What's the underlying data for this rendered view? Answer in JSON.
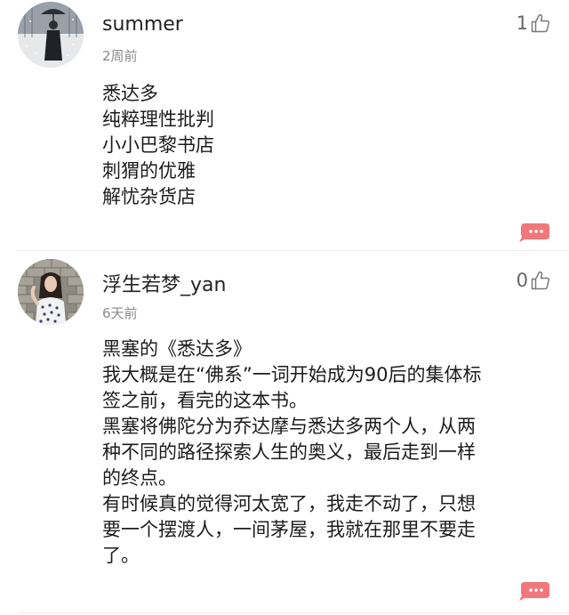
{
  "comments": [
    {
      "username": "summer",
      "time": "2周前",
      "likes": "1",
      "avatar_icon": "avatar-woman-umbrella-snow",
      "lines": [
        "悉达多",
        "纯粹理性批判",
        "小小巴黎书店",
        "刺猬的优雅",
        "解忧杂货店"
      ]
    },
    {
      "username": "浮生若梦_yan",
      "time": "6天前",
      "likes": "0",
      "avatar_icon": "avatar-woman-stone-wall",
      "lines": [
        "黑塞的《悉达多》",
        "我大概是在“佛系”一词开始成为90后的集体标",
        "签之前，看完的这本书。",
        "黑塞将佛陀分为乔达摩与悉达多两个人，从两",
        "种不同的路径探索人生的奥义，最后走到一样",
        "的终点。",
        "有时候真的觉得河太宽了，我走不动了，只想",
        "要一个摆渡人，一间茅屋，我就在那里不要走",
        "了。"
      ]
    }
  ],
  "colors": {
    "reply_button": "#f0777a",
    "username": "#222222",
    "timestamp": "#8a8a8a",
    "divider": "#ececec"
  },
  "icons": {
    "like": "thumbs-up-outline-icon",
    "reply": "speech-bubble-dots-icon"
  }
}
